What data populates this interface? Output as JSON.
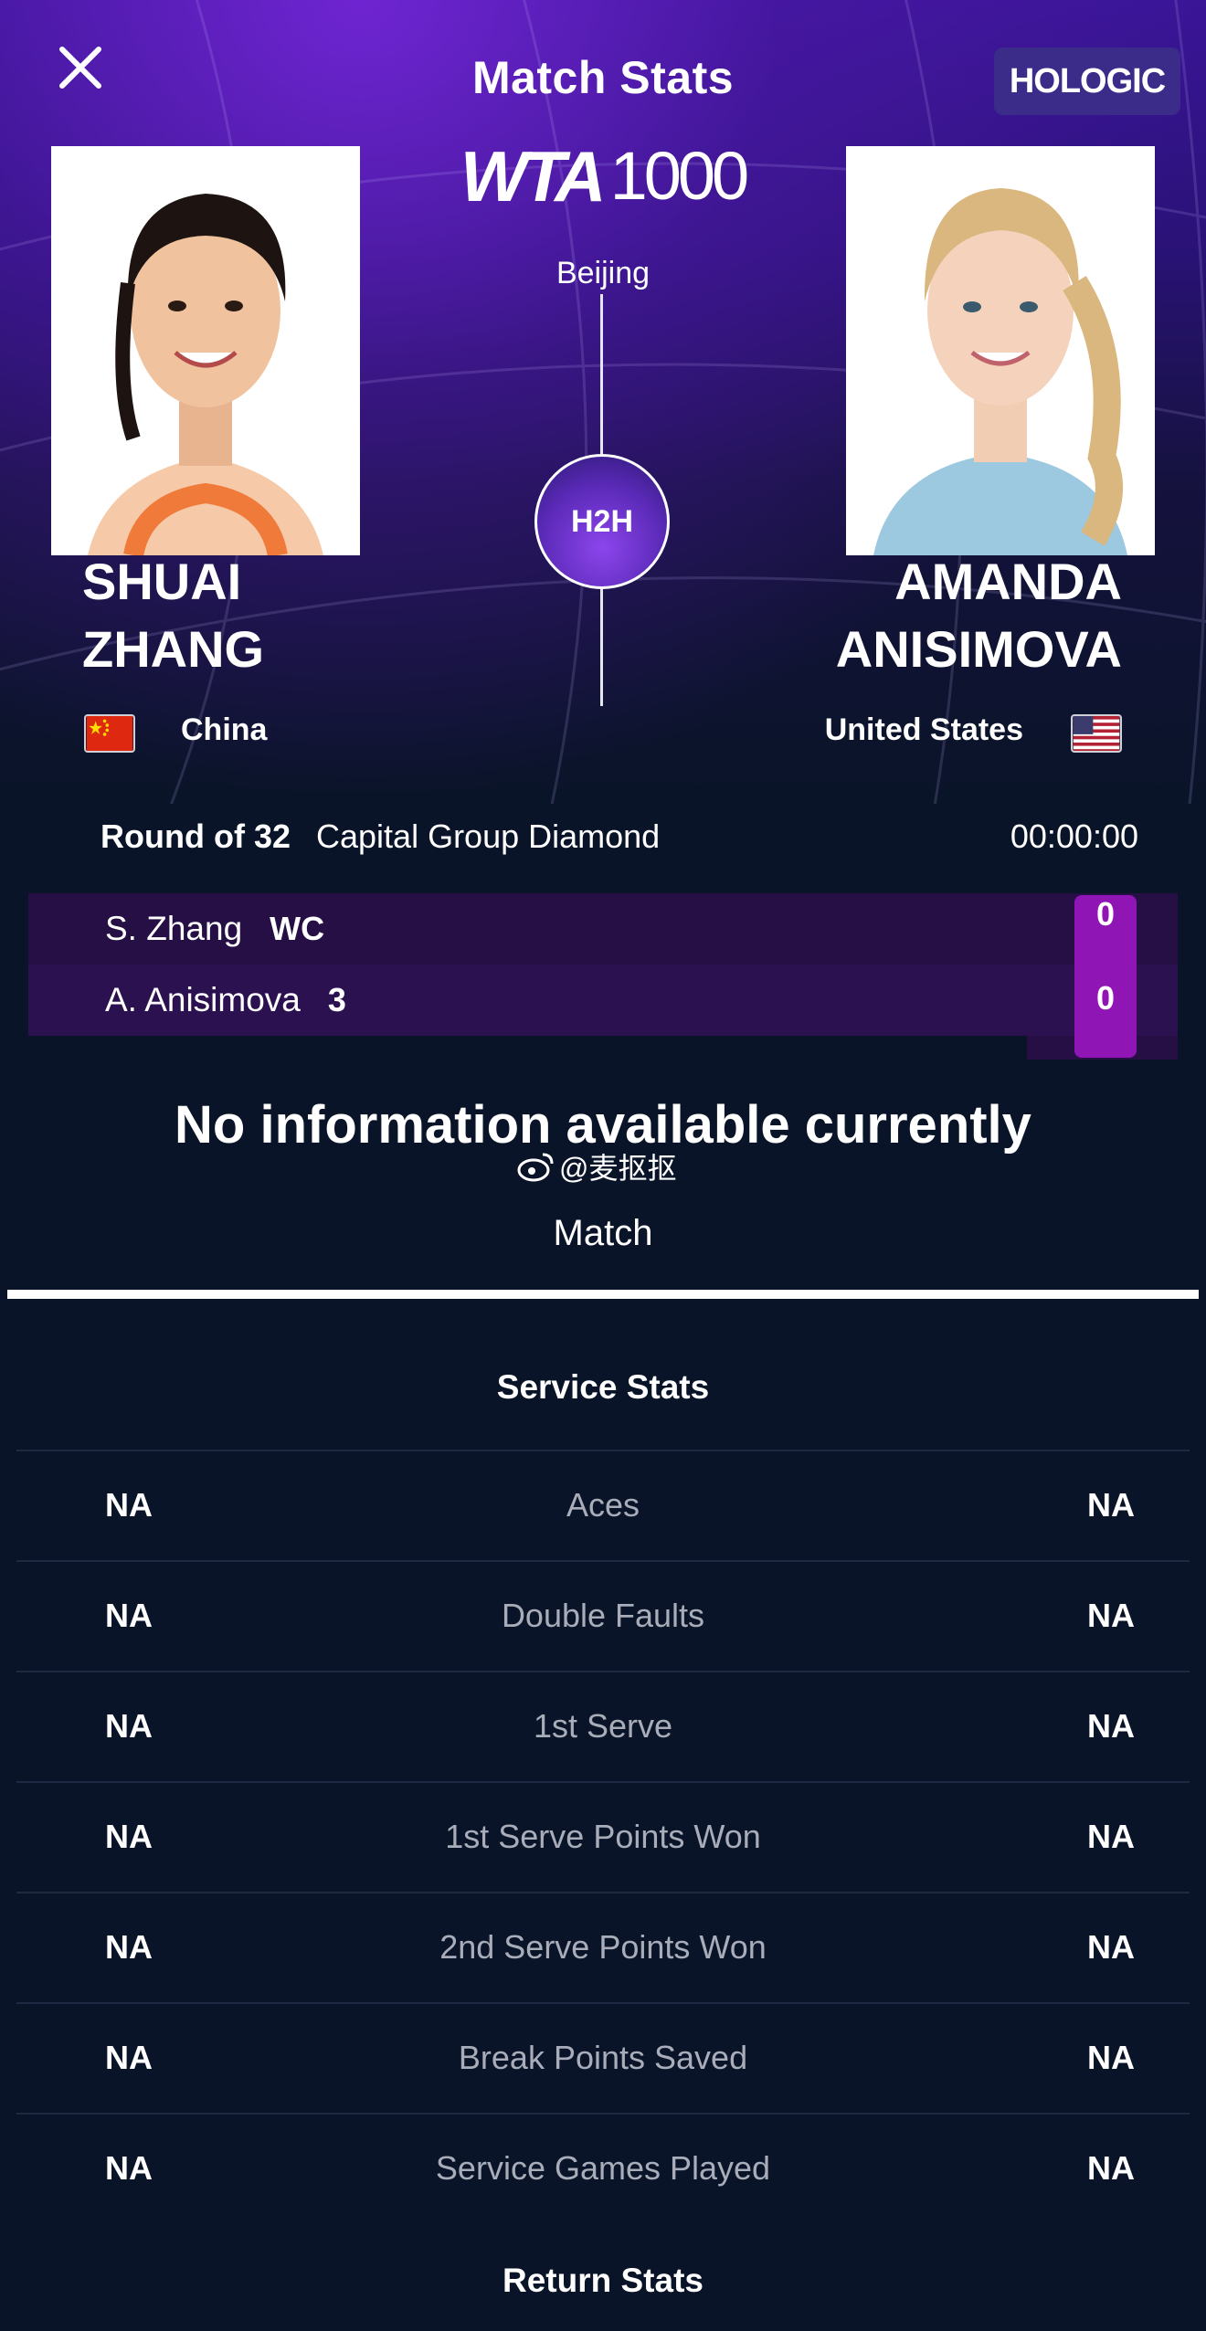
{
  "header": {
    "title": "Match Stats",
    "sponsor": "HOLOGIC",
    "tour_logo": "WTA",
    "tour_tier": "1000",
    "city": "Beijing",
    "h2h_label": "H2H"
  },
  "players": [
    {
      "first_name": "SHUAI",
      "last_name": "ZHANG",
      "country": "China",
      "flag": "china-flag"
    },
    {
      "first_name": "AMANDA",
      "last_name": "ANISIMOVA",
      "country": "United States",
      "flag": "usa-flag"
    }
  ],
  "match": {
    "round": "Round of 32",
    "court": "Capital Group Diamond",
    "duration": "00:00:00"
  },
  "scoreboard": [
    {
      "name": "S. Zhang",
      "seed": "WC",
      "score": "0"
    },
    {
      "name": "A. Anisimova",
      "seed": "3",
      "score": "0"
    }
  ],
  "message": "No information available currently",
  "watermark": "@麦抠抠",
  "tabs": {
    "match": "Match"
  },
  "service_stats": {
    "title": "Service Stats",
    "rows": [
      {
        "label": "Aces",
        "left": "NA",
        "right": "NA"
      },
      {
        "label": "Double Faults",
        "left": "NA",
        "right": "NA"
      },
      {
        "label": "1st Serve",
        "left": "NA",
        "right": "NA"
      },
      {
        "label": "1st Serve Points Won",
        "left": "NA",
        "right": "NA"
      },
      {
        "label": "2nd Serve Points Won",
        "left": "NA",
        "right": "NA"
      },
      {
        "label": "Break Points Saved",
        "left": "NA",
        "right": "NA"
      },
      {
        "label": "Service Games Played",
        "left": "NA",
        "right": "NA"
      }
    ]
  },
  "return_stats": {
    "title": "Return Stats"
  },
  "colors": {
    "background": "#0a1428",
    "hero_purple": "#3a1597",
    "score_highlight": "#8f15b4",
    "scoreboard_row": "#2c1150",
    "stat_label": "#a8adb9"
  }
}
